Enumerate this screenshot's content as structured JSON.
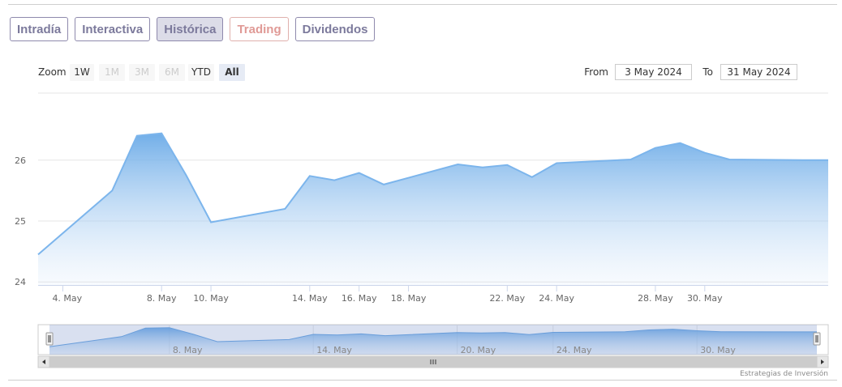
{
  "tabs": [
    {
      "label": "Intradía",
      "active": false
    },
    {
      "label": "Interactiva",
      "active": false
    },
    {
      "label": "Histórica",
      "active": true
    },
    {
      "label": "Trading",
      "active": false
    },
    {
      "label": "Dividendos",
      "active": false
    }
  ],
  "range_selector": {
    "zoom_label": "Zoom",
    "buttons": [
      {
        "label": "1W",
        "state": "normal"
      },
      {
        "label": "1M",
        "state": "disabled"
      },
      {
        "label": "3M",
        "state": "disabled"
      },
      {
        "label": "6M",
        "state": "disabled"
      },
      {
        "label": "YTD",
        "state": "normal"
      },
      {
        "label": "All",
        "state": "selected"
      }
    ],
    "from_label": "From",
    "from_value": "3 May 2024",
    "to_label": "To",
    "to_value": "31 May 2024"
  },
  "credits": "Estrategias de Inversión",
  "colors": {
    "series": "#7cb5ec",
    "tab_border": "#8f8aad",
    "tab_text": "#7c7a9c",
    "trading": "#e09a96"
  },
  "chart_data": {
    "type": "area",
    "title": "",
    "xlabel": "",
    "ylabel": "",
    "x": [
      "2024-05-03",
      "2024-05-06",
      "2024-05-07",
      "2024-05-08",
      "2024-05-09",
      "2024-05-10",
      "2024-05-13",
      "2024-05-14",
      "2024-05-15",
      "2024-05-16",
      "2024-05-17",
      "2024-05-20",
      "2024-05-21",
      "2024-05-22",
      "2024-05-23",
      "2024-05-24",
      "2024-05-27",
      "2024-05-28",
      "2024-05-29",
      "2024-05-30",
      "2024-05-31",
      "2024-06-03",
      "2024-06-04"
    ],
    "values": [
      24.45,
      25.5,
      26.4,
      26.44,
      25.75,
      24.98,
      25.2,
      25.74,
      25.67,
      25.79,
      25.6,
      25.93,
      25.88,
      25.92,
      25.72,
      25.95,
      26.01,
      26.2,
      26.28,
      26.12,
      26.01,
      26.0,
      26.0
    ],
    "ylim": [
      23.95,
      27.1
    ],
    "yticks": [
      24,
      25,
      26
    ],
    "xticks": [
      {
        "date": "2024-05-04",
        "label": "4. May"
      },
      {
        "date": "2024-05-08",
        "label": "8. May"
      },
      {
        "date": "2024-05-10",
        "label": "10. May"
      },
      {
        "date": "2024-05-14",
        "label": "14. May"
      },
      {
        "date": "2024-05-16",
        "label": "16. May"
      },
      {
        "date": "2024-05-18",
        "label": "18. May"
      },
      {
        "date": "2024-05-22",
        "label": "22. May"
      },
      {
        "date": "2024-05-24",
        "label": "24. May"
      },
      {
        "date": "2024-05-28",
        "label": "28. May"
      },
      {
        "date": "2024-05-30",
        "label": "30. May"
      }
    ],
    "navigator_ticks": [
      {
        "date": "2024-05-08",
        "label": "8. May"
      },
      {
        "date": "2024-05-14",
        "label": "14. May"
      },
      {
        "date": "2024-05-20",
        "label": "20. May"
      },
      {
        "date": "2024-05-24",
        "label": "24. May"
      },
      {
        "date": "2024-05-30",
        "label": "30. May"
      }
    ],
    "grid": true,
    "legend": "none"
  }
}
